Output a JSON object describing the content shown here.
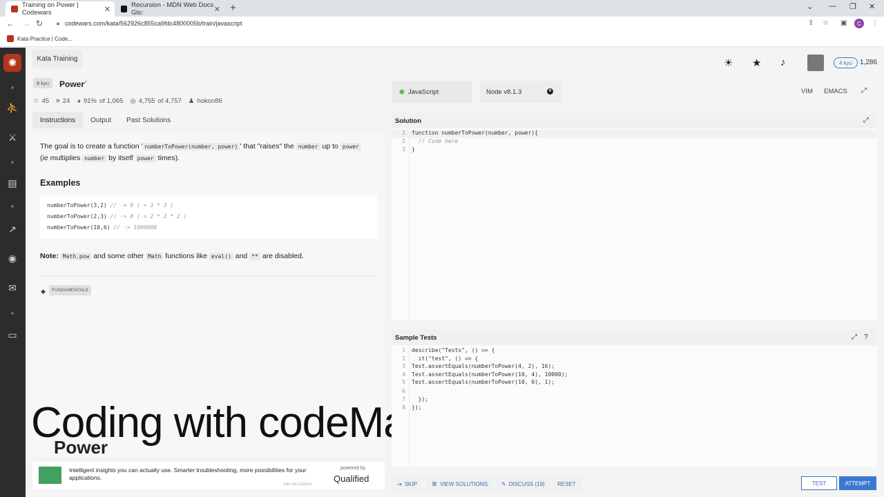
{
  "browser": {
    "tabs": [
      {
        "title": "Training on Power | Codewars",
        "active": true
      },
      {
        "title": "Recursion - MDN Web Docs Glo:",
        "active": false
      }
    ],
    "url": "codewars.com/kata/562926c855ca9fdc4800005b/train/javascript",
    "bookmark": "Kata Practice | Code...",
    "profile_initial": "C"
  },
  "header": {
    "section": "Kata Training",
    "rank_badge": "4 kyu",
    "honor": "1,286"
  },
  "kata": {
    "kyu": "8 kyu",
    "title": "Power",
    "stats": {
      "stars": "45",
      "collections": "24",
      "satisfaction": "91%",
      "satisfaction_of": "of 1,065",
      "completed": "4,755",
      "completed_of": "of 4,757",
      "author": "hokon86"
    },
    "tabs": [
      "Instructions",
      "Output",
      "Past Solutions"
    ],
    "description": {
      "p1_a": "The goal is to create a function '",
      "p1_code": "numberToPower(number, power)",
      "p1_b": "' that \"raises\" the",
      "p1_code2": "number",
      "p1_c": "up to",
      "p1_code3": "power",
      "p2_a": "(",
      "p2_ie": "ie",
      "p2_b": "multiplies",
      "p2_code": "number",
      "p2_c": "by itself",
      "p2_code2": "power",
      "p2_d": "times).",
      "examples_heading": "Examples",
      "examples": [
        {
          "code": "numberToPower(3,2)",
          "comment": "// -> 9 ( = 3 * 3 )"
        },
        {
          "code": "numberToPower(2,3)",
          "comment": "// -> 8 ( = 2 * 2 * 2 )"
        },
        {
          "code": "numberToPower(10,6)",
          "comment": "// -> 1000000"
        }
      ],
      "note_label": "Note:",
      "note_code1": "Math.pow",
      "note_a": "and some other",
      "note_code2": "Math",
      "note_b": "functions like",
      "note_code3": "eval()",
      "note_c": "and",
      "note_code4": "**",
      "note_d": "are disabled."
    },
    "tag": "FUNDAMENTALS"
  },
  "overlay": {
    "title": "Coding with codeManS",
    "subtitle": "Power"
  },
  "ad": {
    "text": "Intelligent insights you can actually use. Smarter troubleshooting, more possibilities for your applications.",
    "powered": "powered by",
    "brand": "Qualified",
    "via": "Ads via Carbon"
  },
  "editor": {
    "language": "JavaScript",
    "runtime": "Node v8.1.3",
    "modes": [
      "VIM",
      "EMACS"
    ],
    "solution_title": "Solution",
    "solution_lines": [
      {
        "n": "1",
        "text": "function numberToPower(number, power){"
      },
      {
        "n": "2",
        "text": "  // Code here"
      },
      {
        "n": "3",
        "text": "}"
      }
    ],
    "tests_title": "Sample Tests",
    "test_lines": [
      {
        "n": "1",
        "text": "describe(\"Tests\", () => {"
      },
      {
        "n": "2",
        "text": "  it(\"test\", () => {"
      },
      {
        "n": "3",
        "text": "Test.assertEquals(numberToPower(4, 2), 16);"
      },
      {
        "n": "4",
        "text": "Test.assertEquals(numberToPower(10, 4), 10000);"
      },
      {
        "n": "5",
        "text": "Test.assertEquals(numberToPower(10, 0), 1);"
      },
      {
        "n": "6",
        "text": ""
      },
      {
        "n": "7",
        "text": "  });"
      },
      {
        "n": "8",
        "text": "});"
      }
    ]
  },
  "actions": {
    "skip": "SKIP",
    "view_solutions": "VIEW SOLUTIONS",
    "discuss": "DISCUSS (19)",
    "reset": "RESET",
    "test": "TEST",
    "attempt": "ATTEMPT"
  }
}
